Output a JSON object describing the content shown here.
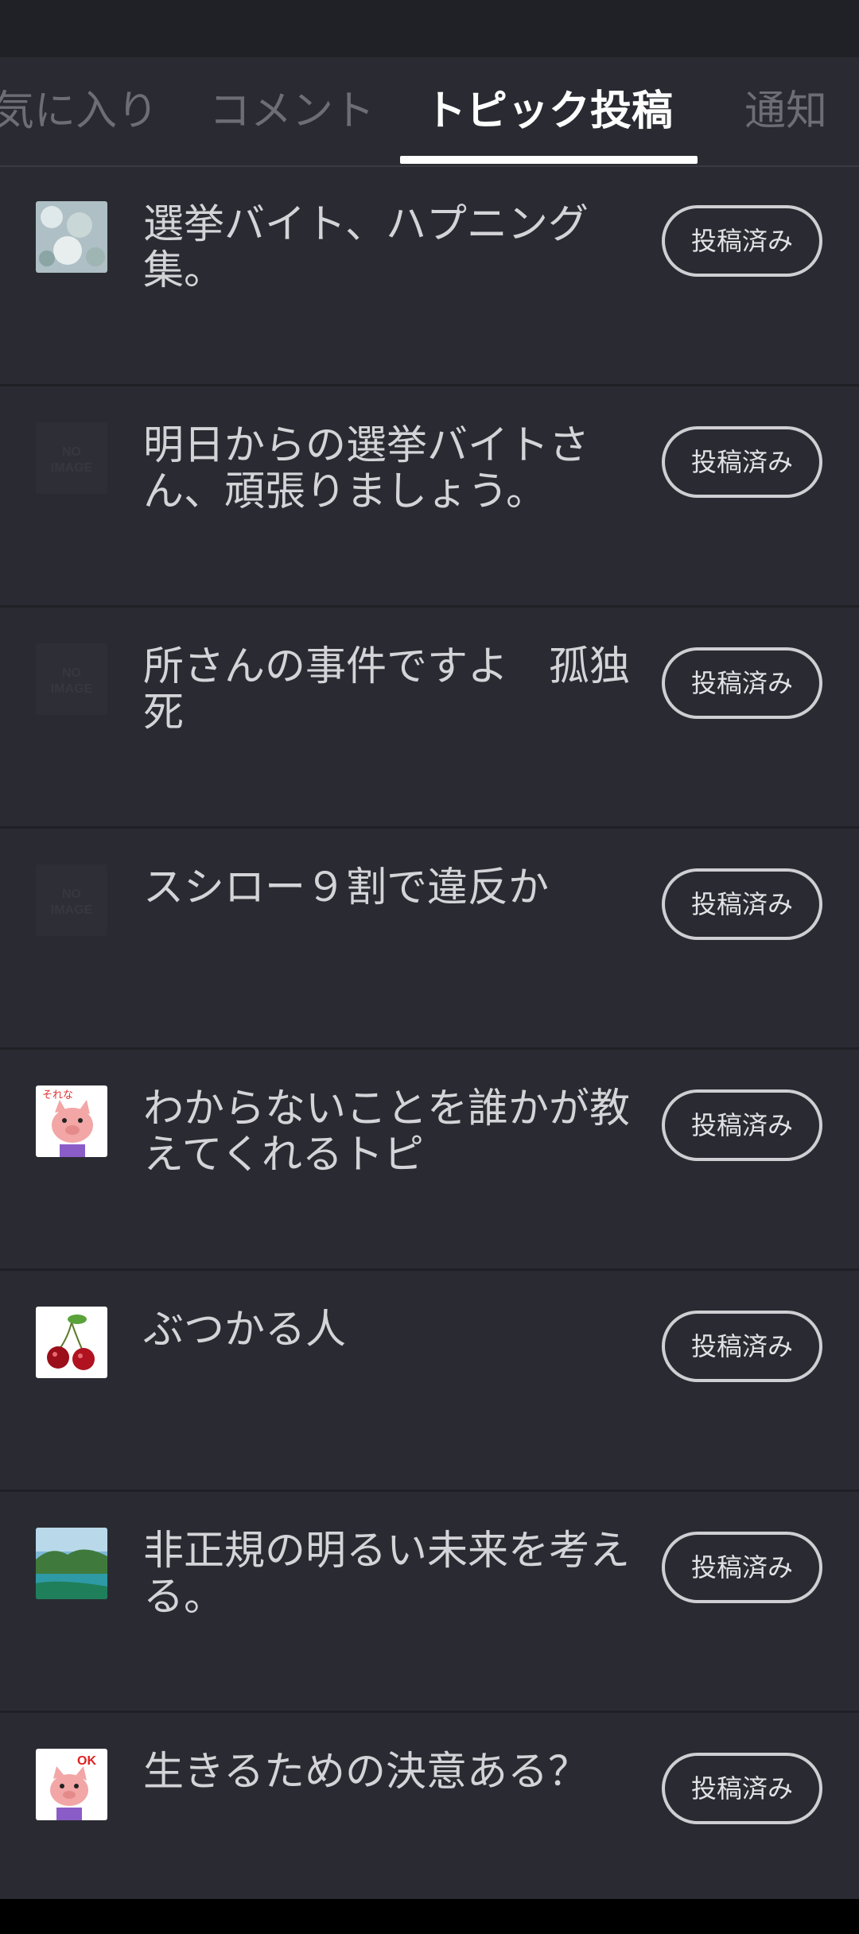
{
  "tabs": [
    {
      "label": "気に入り",
      "active": false
    },
    {
      "label": "コメント",
      "active": false
    },
    {
      "label": "トピック投稿",
      "active": true
    },
    {
      "label": "通知",
      "active": false
    }
  ],
  "topics": [
    {
      "title": "選挙バイト、ハプニング集。",
      "status": "投稿済み",
      "thumb": "flowers-photo"
    },
    {
      "title": "明日からの選挙バイトさん、頑張りましょう。",
      "status": "投稿済み",
      "thumb": "no-image",
      "thumb_text": "NO IMAGE"
    },
    {
      "title": "所さんの事件ですよ　孤独死",
      "status": "投稿済み",
      "thumb": "no-image",
      "thumb_text": "NO IMAGE"
    },
    {
      "title": "スシロー９割で違反か",
      "status": "投稿済み",
      "thumb": "no-image",
      "thumb_text": "NO IMAGE"
    },
    {
      "title": "わからないことを誰かが教えてくれるトピ",
      "status": "投稿済み",
      "thumb": "pig-sticker",
      "thumb_text": "それな"
    },
    {
      "title": "ぶつかる人",
      "status": "投稿済み",
      "thumb": "cherry-photo"
    },
    {
      "title": "非正規の明るい未来を考える。",
      "status": "投稿済み",
      "thumb": "island-photo"
    },
    {
      "title": "生きるための決意ある？",
      "status": "投稿済み",
      "thumb": "pig-ok-sticker",
      "thumb_text": "OK"
    }
  ]
}
